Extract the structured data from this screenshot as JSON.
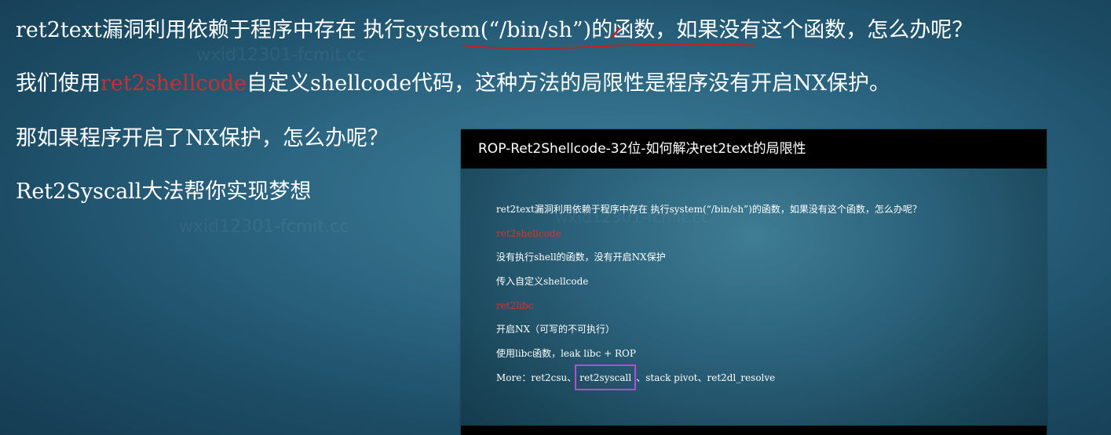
{
  "slide": {
    "line1": "ret2text漏洞利用依赖于程序中存在 执行system(“/bin/sh”)的函数，如果没有这个函数，怎么办呢？",
    "line2_prefix": "我们使用",
    "line2_highlight": "ret2shellcode",
    "line2_suffix": "自定义shellcode代码，这种方法的局限性是程序没有开启NX保护。",
    "line3": "那如果程序开启了NX保护，怎么办呢？",
    "line4": "Ret2Syscall大法帮你实现梦想"
  },
  "watermark": "wxid12301-fcmit.cc",
  "inset": {
    "title": "ROP-Ret2Shellcode-32位-如何解决ret2text的局限性",
    "lines": [
      "ret2text漏洞利用依赖于程序中存在 执行system(“/bin/sh”)的函数，如果没有这个函数，怎么办呢？",
      "ret2shellcode",
      "没有执行shell的函数，没有开启NX保护",
      "传入自定义shellcode",
      "ret2libc",
      "开启NX（可写的不可执行）",
      "使用libc函数，leak libc + ROP"
    ],
    "more_prefix": "More：ret2csu、",
    "more_highlight": "ret2syscall",
    "more_suffix": "、stack pivot、ret2dl_resolve"
  },
  "colors": {
    "highlight_red": "#d42a2a",
    "annotation_red": "#c81e1e",
    "box_purple": "#b64bd8",
    "header_black": "#000000"
  }
}
